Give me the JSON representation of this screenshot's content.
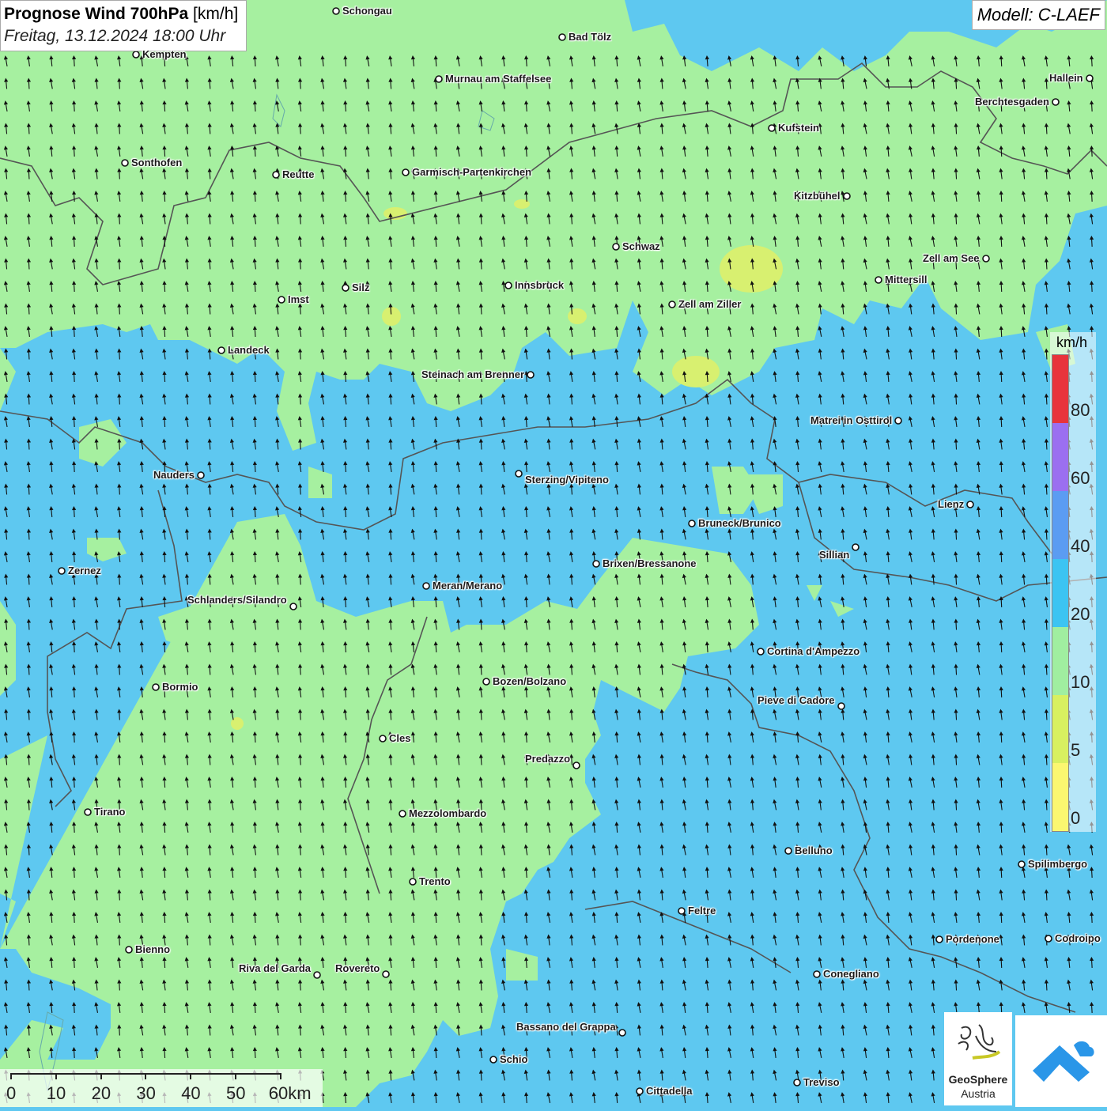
{
  "title": {
    "main": "Prognose Wind 700hPa",
    "unit": "[km/h]",
    "subtitle": "Freitag, 13.12.2024 18:00 Uhr"
  },
  "model_label": "Modell: C-LAEF",
  "colors": {
    "ocean_blue": "#5ec8f0",
    "green": "#a6f0a0",
    "yellowgreen": "#d8f070",
    "border": "#555555",
    "arrow": "#111111"
  },
  "cities": [
    {
      "name": "Schongau"
    },
    {
      "name": "Bad Tölz"
    },
    {
      "name": "Kempten"
    },
    {
      "name": "Murnau am Staffelsee"
    },
    {
      "name": "Hallein"
    },
    {
      "name": "Berchtesgaden"
    },
    {
      "name": "Kufstein"
    },
    {
      "name": "Sonthofen"
    },
    {
      "name": "Reutte"
    },
    {
      "name": "Garmisch-Partenkirchen"
    },
    {
      "name": "Kitzbühel"
    },
    {
      "name": "Schwaz"
    },
    {
      "name": "Zell am See"
    },
    {
      "name": "Innsbruck"
    },
    {
      "name": "Mittersill"
    },
    {
      "name": "Imst"
    },
    {
      "name": "Silz"
    },
    {
      "name": "Zell am Ziller"
    },
    {
      "name": "Landeck"
    },
    {
      "name": "Steinach am Brenner"
    },
    {
      "name": "Matrei in Osttirol"
    },
    {
      "name": "Nauders"
    },
    {
      "name": "Sterzing/Vipiteno"
    },
    {
      "name": "Lienz"
    },
    {
      "name": "Bruneck/Brunico"
    },
    {
      "name": "Sillian"
    },
    {
      "name": "Brixen/Bressanone"
    },
    {
      "name": "Zernez"
    },
    {
      "name": "Meran/Merano"
    },
    {
      "name": "Schlanders/Silandro"
    },
    {
      "name": "Cortina d'Ampezzo"
    },
    {
      "name": "Bozen/Bolzano"
    },
    {
      "name": "Bormio"
    },
    {
      "name": "Pieve di Cadore"
    },
    {
      "name": "Cles"
    },
    {
      "name": "Predazzo"
    },
    {
      "name": "Tirano"
    },
    {
      "name": "Mezzolombardo"
    },
    {
      "name": "Belluno"
    },
    {
      "name": "Spilimbergo"
    },
    {
      "name": "Trento"
    },
    {
      "name": "Feltre"
    },
    {
      "name": "Pordenone"
    },
    {
      "name": "Codroipo"
    },
    {
      "name": "Bienno"
    },
    {
      "name": "Riva del Garda"
    },
    {
      "name": "Rovereto"
    },
    {
      "name": "Conegliano"
    },
    {
      "name": "Bassano del Grappa"
    },
    {
      "name": "Schio"
    },
    {
      "name": "Treviso"
    },
    {
      "name": "Cittadella"
    }
  ],
  "legend": {
    "unit": "km/h",
    "ticks": [
      "80",
      "60",
      "40",
      "20",
      "10",
      "5",
      "0"
    ],
    "segments": [
      {
        "color": "#e8343c"
      },
      {
        "color": "#9b6ff0"
      },
      {
        "color": "#5b9cf2"
      },
      {
        "color": "#3cc4f2"
      },
      {
        "color": "#a0eea0"
      },
      {
        "color": "#d8f060"
      },
      {
        "color": "#fbf770"
      }
    ]
  },
  "scale_bar": {
    "labels": [
      "0",
      "10",
      "20",
      "30",
      "40",
      "50",
      "60km"
    ]
  },
  "logos": {
    "geosphere_line1": "GeoSphere",
    "geosphere_line2": "Austria"
  }
}
